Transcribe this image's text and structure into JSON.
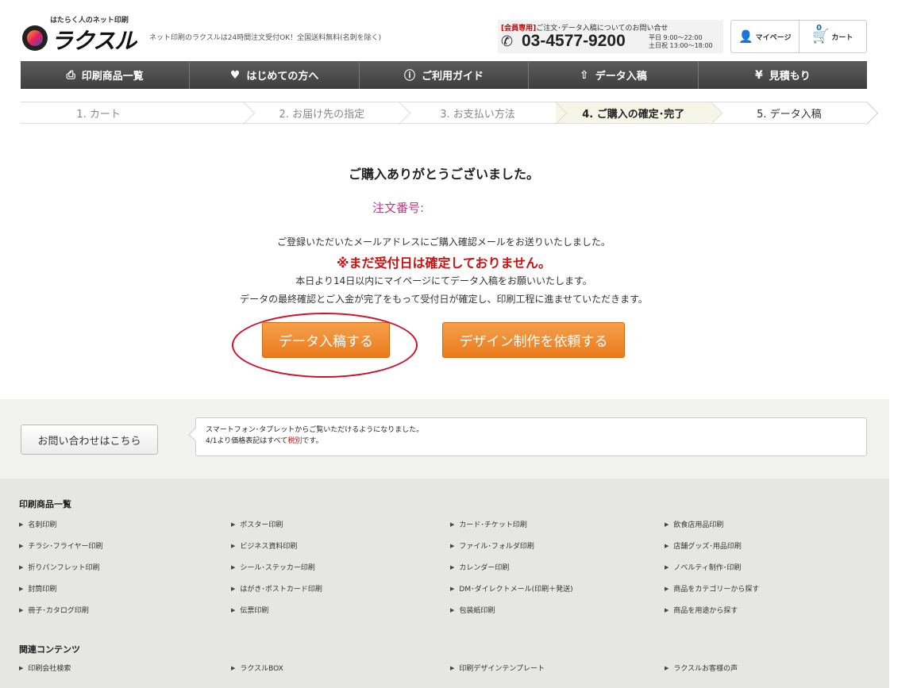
{
  "header": {
    "logo_tag": "はたらく人のネット印刷",
    "logo_name": "ラクスル",
    "tagline": "ネット印刷のラクスルは24時間注文受付OK！全国送料無料(名刺を除く)",
    "contact_member": "[会員専用]",
    "contact_label": "ご注文･データ入稿についてのお問い合せ",
    "phone": "03-4577-9200",
    "hours_weekday": "平日 9:00〜22:00",
    "hours_weekend": "土日祝 13:00〜18:00",
    "mypage": "マイページ",
    "cart": "カート",
    "cart_count": "0"
  },
  "nav": [
    {
      "label": "印刷商品一覧",
      "icon": "printer-icon"
    },
    {
      "label": "はじめての方へ",
      "icon": "heart-icon"
    },
    {
      "label": "ご利用ガイド",
      "icon": "question-icon"
    },
    {
      "label": "データ入稿",
      "icon": "upload-icon"
    },
    {
      "label": "見積もり",
      "icon": "yen-icon"
    }
  ],
  "steps": [
    "1. カート",
    "2. お届け先の指定",
    "3. お支払い方法",
    "4. ご購入の確定･完了",
    "5. データ入稿"
  ],
  "main": {
    "thanks": "ご購入ありがとうございました。",
    "order_no": "注文番号:",
    "msg1": "ご登録いただいたメールアドレスにご購入確認メールをお送りいたしました。",
    "warning": "※まだ受付日は確定しておりません。",
    "msg2": "本日より14日以内にマイページにてデータ入稿をお願いいたします。",
    "msg3": "データの最終確認とご入金が完了をもって受付日が確定し、印刷工程に進ませていただきます。",
    "btn_data": "データ入稿する",
    "btn_design": "デザイン制作を依頼する"
  },
  "info": {
    "contact_btn": "お問い合わせはこちら",
    "notice1": "スマートフォン･タブレットからご覧いただけるようになりました。",
    "notice2_pre": "4/1より価格表記はすべて",
    "notice2_red": "税別",
    "notice2_post": "です。"
  },
  "footer": {
    "products_title": "印刷商品一覧",
    "products": [
      "名刺印刷",
      "ポスター印刷",
      "カード･チケット印刷",
      "飲食店用品印刷",
      "チラシ･フライヤー印刷",
      "ビジネス資料印刷",
      "ファイル･フォルダ印刷",
      "店舗グッズ･用品印刷",
      "折りパンフレット印刷",
      "シール･ステッカー印刷",
      "カレンダー印刷",
      "ノベルティ制作･印刷",
      "封筒印刷",
      "はがき･ポストカード印刷",
      "DM･ダイレクトメール(印刷＋発送)",
      "商品をカテゴリーから探す",
      "冊子･カタログ印刷",
      "伝票印刷",
      "包装紙印刷",
      "商品を用途から探す"
    ],
    "related_title": "関連コンテンツ",
    "related": [
      "印刷会社検索",
      "ラクスルBOX",
      "印刷デザインテンプレート",
      "ラクスルお客様の声"
    ]
  }
}
